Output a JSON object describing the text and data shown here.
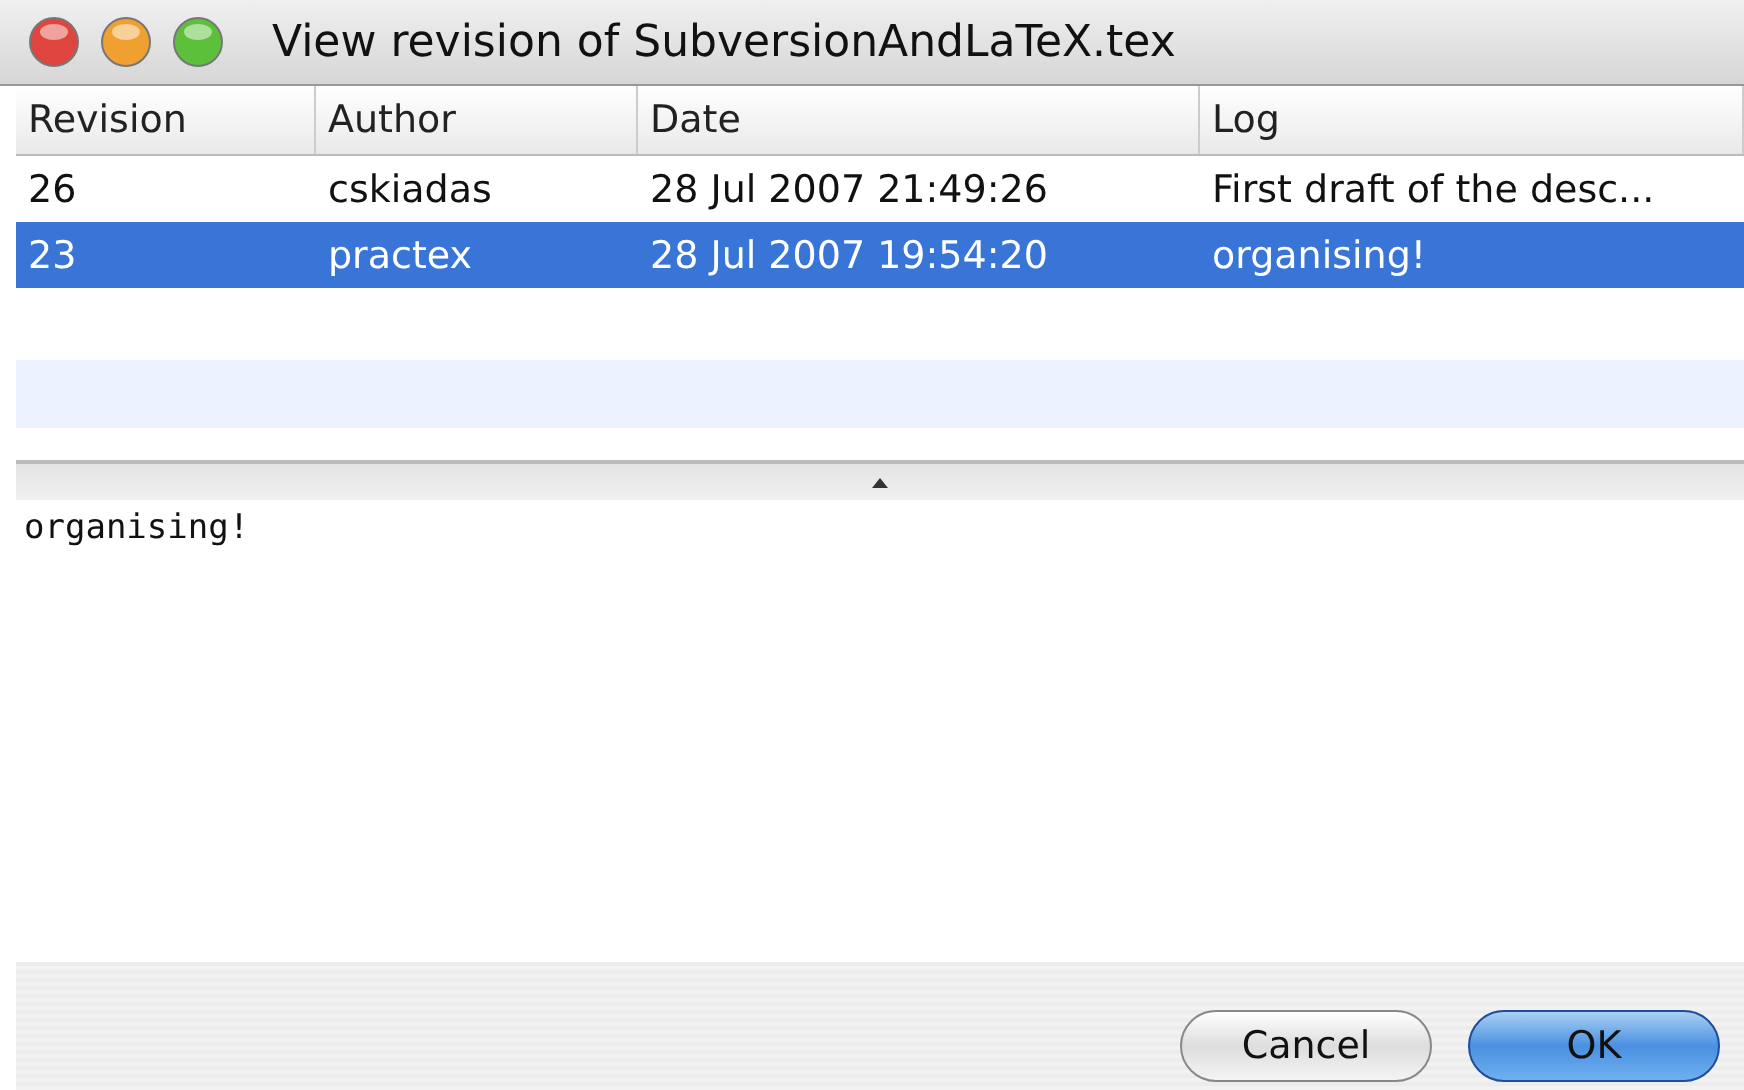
{
  "window": {
    "title": "View revision of SubversionAndLaTeX.tex"
  },
  "table": {
    "columns": [
      "Revision",
      "Author",
      "Date",
      "Log"
    ],
    "rows": [
      {
        "cells": [
          "26",
          "cskiadas",
          "28 Jul 2007 21:49:26",
          "First draft of the desc..."
        ],
        "selected": false
      },
      {
        "cells": [
          "23",
          "practex",
          "28 Jul 2007 19:54:20",
          "organising!"
        ],
        "selected": true
      }
    ]
  },
  "detail": {
    "text": "organising!"
  },
  "buttons": [
    {
      "label": "Cancel",
      "kind": "default"
    },
    {
      "label": "OK",
      "kind": "primary"
    }
  ]
}
